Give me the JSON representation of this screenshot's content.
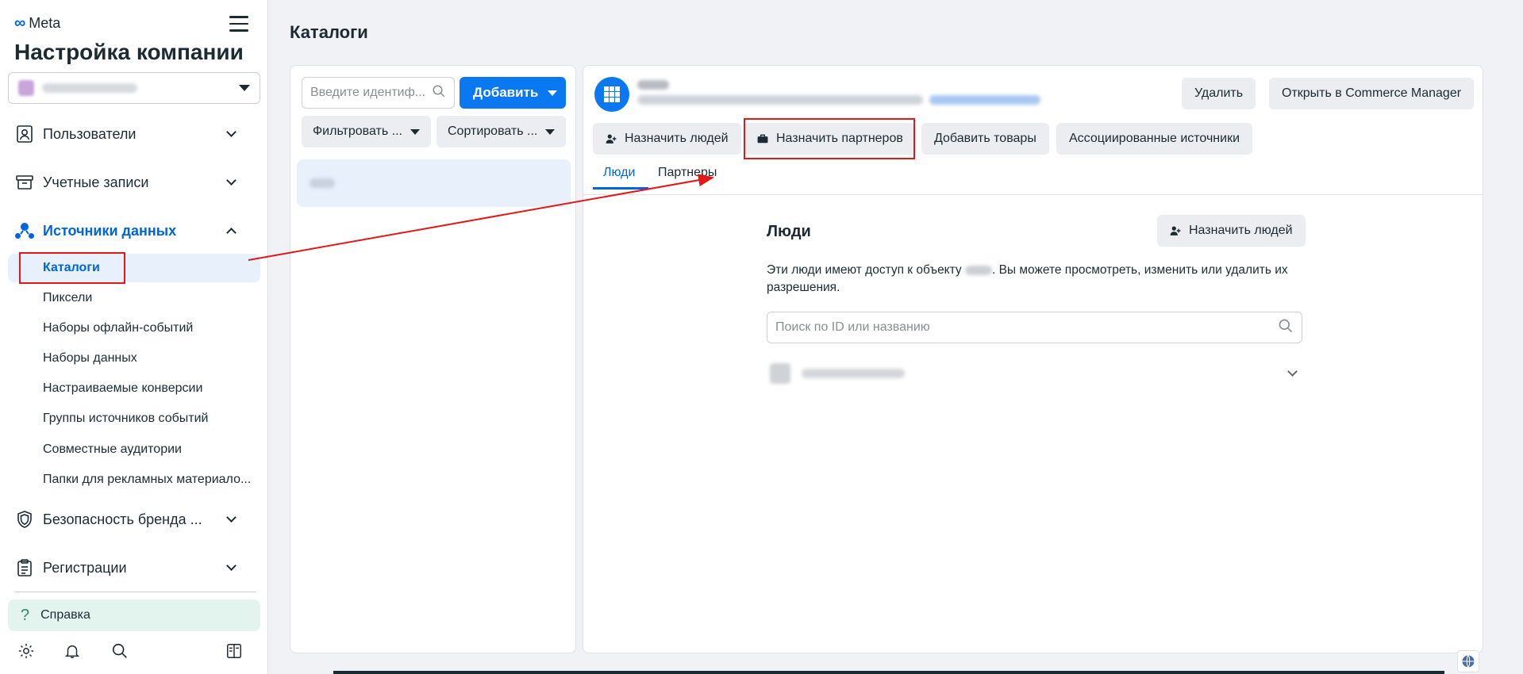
{
  "brand": {
    "name": "Meta"
  },
  "sidebar": {
    "title": "Настройка компании",
    "nav": [
      {
        "label": "Пользователи"
      },
      {
        "label": "Учетные записи"
      },
      {
        "label": "Источники данных"
      },
      {
        "label": "Безопасность бренда ..."
      },
      {
        "label": "Регистрации"
      }
    ],
    "data_sources": [
      {
        "label": "Каталоги"
      },
      {
        "label": "Пиксели"
      },
      {
        "label": "Наборы офлайн-событий"
      },
      {
        "label": "Наборы данных"
      },
      {
        "label": "Настраиваемые конверсии"
      },
      {
        "label": "Группы источников событий"
      },
      {
        "label": "Совместные аудитории"
      },
      {
        "label": "Папки для рекламных материало..."
      }
    ],
    "help": "Справка"
  },
  "page": {
    "title": "Каталоги"
  },
  "list": {
    "search_placeholder": "Введите идентиф...",
    "add_label": "Добавить",
    "filter_label": "Фильтровать ...",
    "sort_label": "Сортировать ..."
  },
  "detail": {
    "delete_label": "Удалить",
    "open_commerce_label": "Открыть в Commerce Manager",
    "assign_people_label": "Назначить людей",
    "assign_partners_label": "Назначить партнеров",
    "add_products_label": "Добавить товары",
    "associated_sources_label": "Ассоциированные источники",
    "tabs": [
      {
        "label": "Люди"
      },
      {
        "label": "Партнеры"
      }
    ],
    "people": {
      "title": "Люди",
      "assign_label": "Назначить людей",
      "desc_before": "Эти люди имеют доступ к объекту",
      "desc_after": ". Вы можете просмотреть, изменить или удалить их разрешения.",
      "search_placeholder": "Поиск по ID или названию"
    }
  },
  "colors": {
    "accent": "#0064e0",
    "primary_button": "#0a78f0",
    "annotation": "#e01818"
  }
}
